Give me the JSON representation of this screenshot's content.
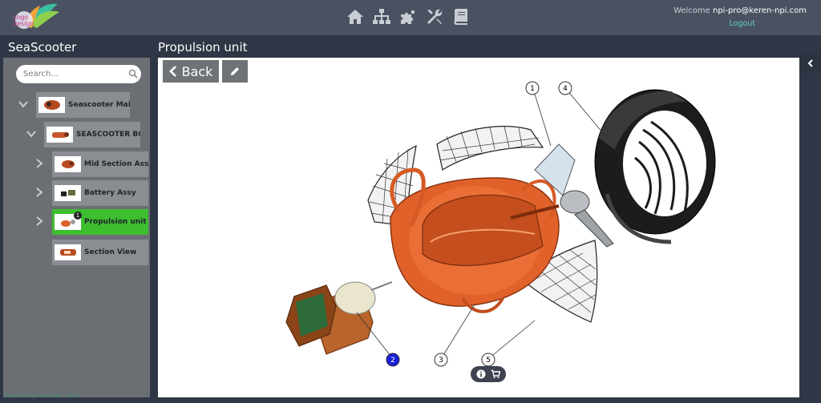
{
  "header": {
    "logo_text_1": "Logo",
    "logo_text_2": "design",
    "nav_icons": [
      "home-icon",
      "sitemap-icon",
      "puzzle-icon",
      "tools-icon",
      "book-icon"
    ],
    "welcome_prefix": "Welcome ",
    "user": "npi-pro@keren-npi.com",
    "logout": "Logout"
  },
  "app_title": "SeaScooter",
  "page_title": "Propulsion unit",
  "sidebar": {
    "search_placeholder": "Search...",
    "tree": [
      {
        "label": "Seascooter Main",
        "level": 0,
        "expanded": true
      },
      {
        "label": "SEASCOOTER BOO",
        "level": 1,
        "expanded": true
      },
      {
        "label": "Mid Section Assy",
        "level": 2,
        "expanded": false
      },
      {
        "label": "Battery Assy",
        "level": 2,
        "expanded": false
      },
      {
        "label": "Propulsion unit",
        "level": 2,
        "expanded": false,
        "active": true,
        "badge": "1"
      },
      {
        "label": "Section View",
        "level": 2,
        "leaf": true
      }
    ],
    "powered_by": "Powered by Keren NPI - v2.2"
  },
  "viewer": {
    "back_label": "Back",
    "callouts": [
      "1",
      "2",
      "3",
      "4",
      "5"
    ],
    "selected_callout": "2"
  },
  "colors": {
    "topbar": "#4a5262",
    "sidebar": "#6b6f74",
    "node": "#8a8e93",
    "active_node": "#3dbe2e",
    "accent_link": "#5fd0c0",
    "selected_callout": "#1a1fd8",
    "orange": "#e0622a"
  }
}
